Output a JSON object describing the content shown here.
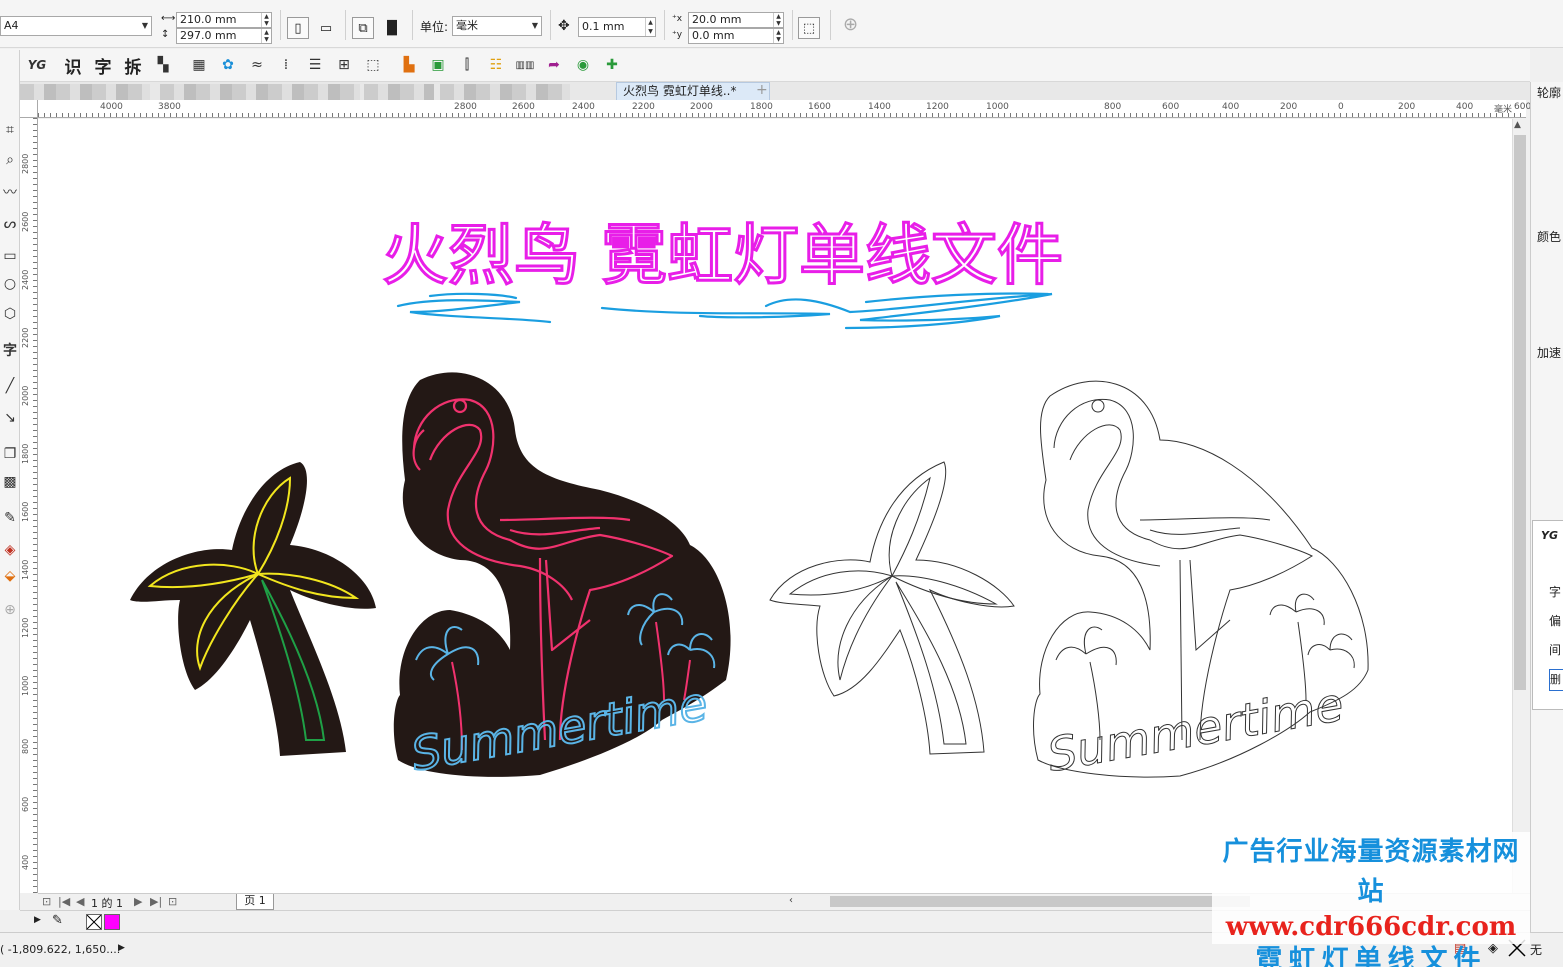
{
  "propbar": {
    "page_size": "A4",
    "width": "210.0 mm",
    "height": "297.0 mm",
    "units_label": "单位:",
    "units_value": "毫米",
    "nudge": "0.1 mm",
    "dup_x": "20.0 mm",
    "dup_y": "0.0 mm"
  },
  "toolbar2": {
    "cn_buttons": [
      "识",
      "字",
      "拆"
    ]
  },
  "tabs": {
    "document": "火烈鸟 霓虹灯单线..*",
    "add": "+"
  },
  "ruler": {
    "h_ticks": [
      "4000",
      "3800",
      "2800",
      "2600",
      "2400",
      "2200",
      "2000",
      "1800",
      "1600",
      "1400",
      "1200",
      "1000",
      "800",
      "600",
      "400",
      "200",
      "0",
      "200",
      "400",
      "600"
    ],
    "h_unit": "毫米",
    "v_ticks": [
      "2800",
      "2600",
      "2400",
      "2200",
      "2000",
      "1800",
      "1600",
      "1400",
      "1200",
      "1000",
      "800",
      "600",
      "400"
    ]
  },
  "artwork": {
    "title": "火烈鸟 霓虹灯单线文件",
    "script_text": "Summertime",
    "colors": {
      "title": "#e81ee8",
      "underline": "#1a9ee0",
      "backing": "#231815",
      "flamingo": "#f0326e",
      "palm_leaf": "#f2e61e",
      "palm_trunk": "#1fa046",
      "summer": "#5ab4e6"
    }
  },
  "docker": {
    "outline": "轮廓",
    "color": "颜色",
    "accelerate": "加速",
    "panel_header": "YG",
    "panel_items": [
      "字",
      "偏",
      "间"
    ],
    "panel_button": "删"
  },
  "pagenav": {
    "page_of": "1 的 1",
    "page_tab": "页 1"
  },
  "status": {
    "coords": "( -1,809.622, 1,650....",
    "fill_none": "无"
  },
  "watermark": {
    "line1": "广告行业海量资源素材网站",
    "line2": "www.cdr666cdr.com",
    "line3": "霓虹灯单线文件"
  }
}
